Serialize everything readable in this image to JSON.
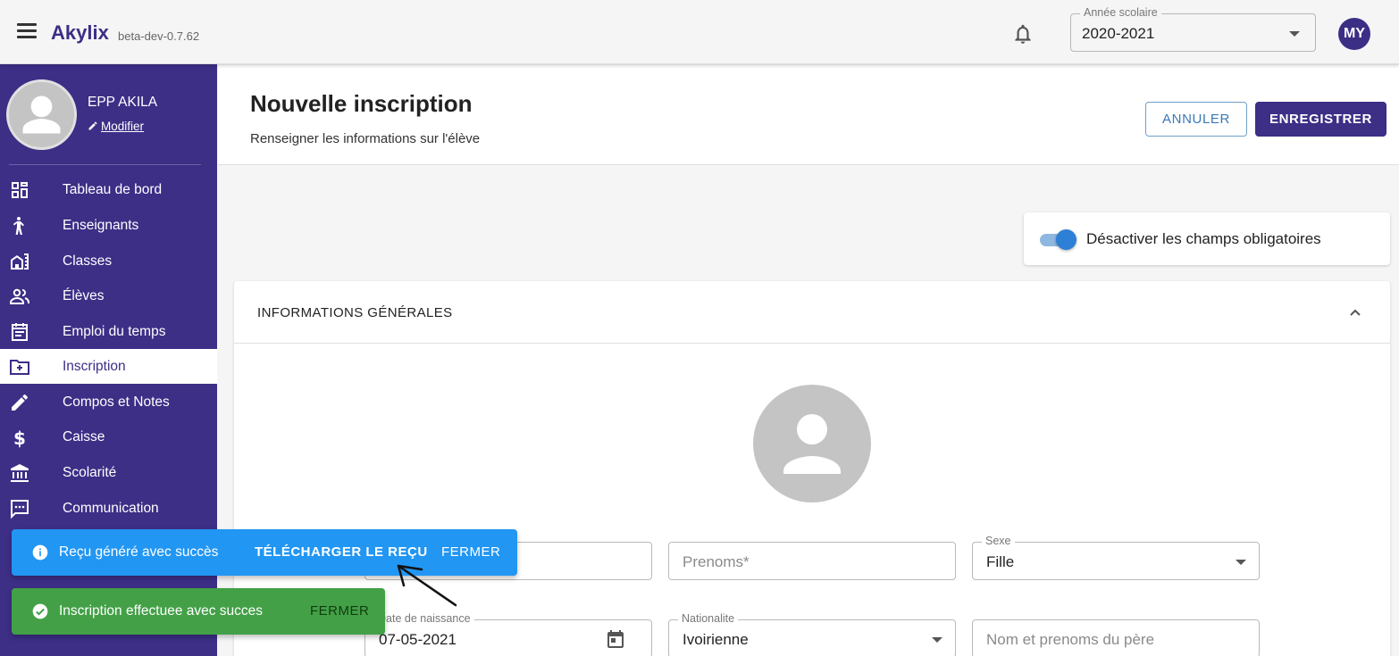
{
  "topbar": {
    "brand": "Akylix",
    "version": "beta-dev-0.7.62",
    "year_label": "Année scolaire",
    "year_value": "2020-2021",
    "user_initials": "MY"
  },
  "sidebar": {
    "profile_name": "EPP AKILA",
    "profile_edit": "Modifier",
    "items": [
      {
        "label": "Tableau de bord",
        "icon": "dashboard-icon"
      },
      {
        "label": "Enseignants",
        "icon": "teacher-icon"
      },
      {
        "label": "Classes",
        "icon": "building-icon"
      },
      {
        "label": "Élèves",
        "icon": "people-icon"
      },
      {
        "label": "Emploi du temps",
        "icon": "calendar-icon"
      },
      {
        "label": "Inscription",
        "icon": "folder-plus-icon",
        "active": true
      },
      {
        "label": "Compos et Notes",
        "icon": "pencil-icon"
      },
      {
        "label": "Caisse",
        "icon": "dollar-icon"
      },
      {
        "label": "Scolarité",
        "icon": "bank-icon"
      },
      {
        "label": "Communication",
        "icon": "message-icon"
      }
    ]
  },
  "header": {
    "title": "Nouvelle inscription",
    "subtitle": "Renseigner les informations sur l'élève",
    "cancel_label": "ANNULER",
    "save_label": "ENREGISTRER"
  },
  "toggle": {
    "label": "Désactiver les champs obligatoires",
    "checked": true
  },
  "form": {
    "section_title": "INFORMATIONS GÉNÉRALES",
    "prenoms_placeholder": "Prenoms*",
    "sexe_label": "Sexe",
    "sexe_value": "Fille",
    "dob_label": "Date de naissance",
    "dob_value": "07-05-2021",
    "nationalite_label": "Nationalite",
    "nationalite_value": "Ivoirienne",
    "pere_placeholder": "Nom et prenoms du père"
  },
  "snackbars": {
    "info": {
      "message": "Reçu généré avec succès",
      "download_label": "TÉLÉCHARGER LE REÇU",
      "close_label": "FERMER"
    },
    "success": {
      "message": "Inscription effectuee avec succes",
      "close_label": "FERMER"
    }
  },
  "colors": {
    "primary": "#3d2e86",
    "info": "#2196f3",
    "success": "#43a047",
    "switch": "#2e7fd6"
  }
}
